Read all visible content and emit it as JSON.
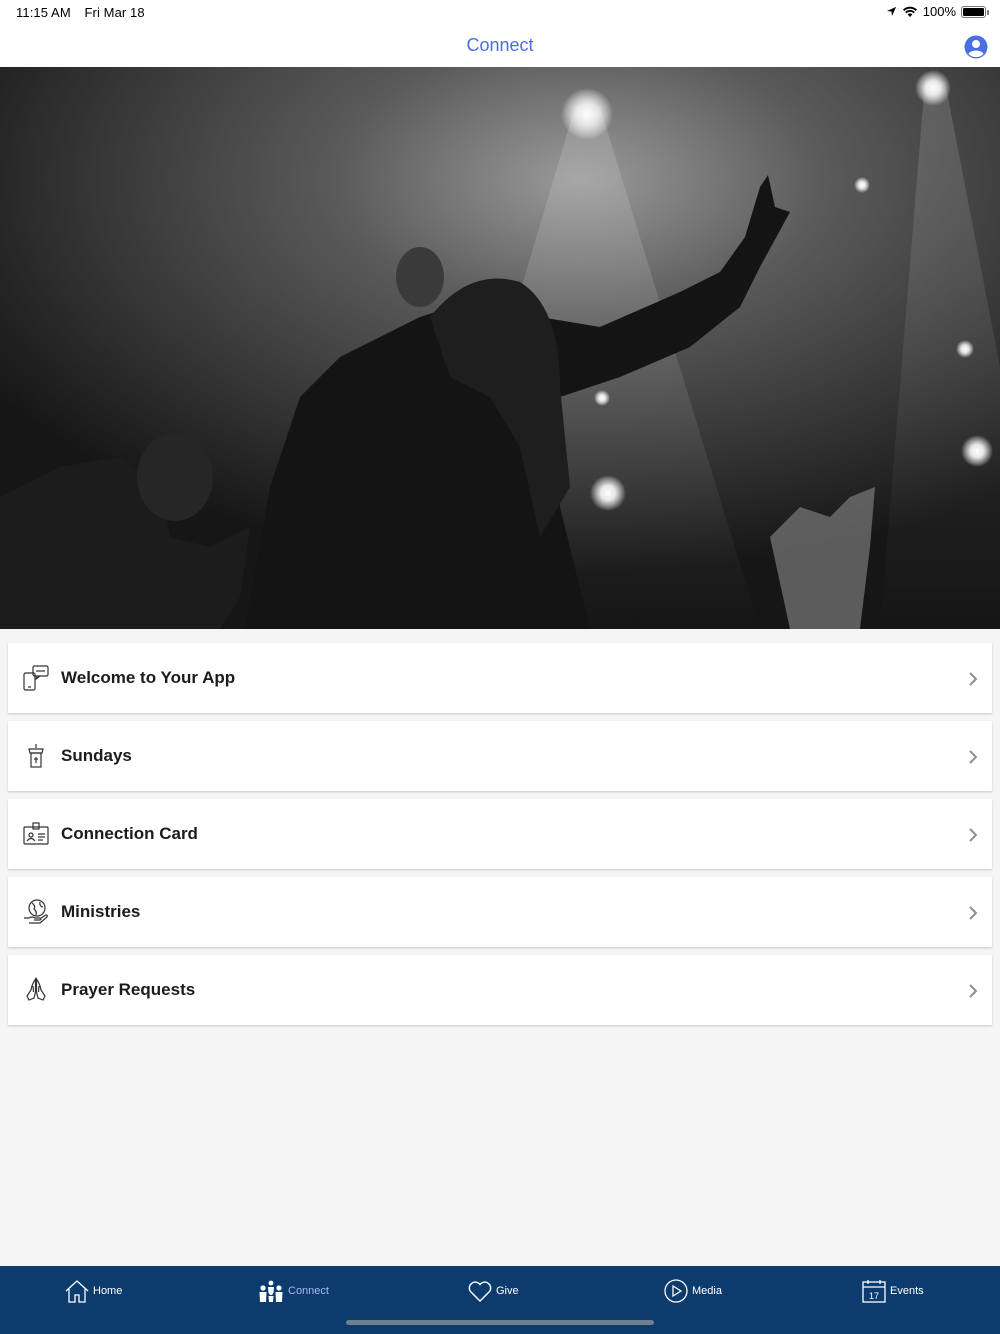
{
  "status_bar": {
    "time": "11:15 AM",
    "date": "Fri Mar 18",
    "battery": "100%",
    "icons": [
      "location-arrow-icon",
      "wifi-icon",
      "battery-icon"
    ]
  },
  "nav": {
    "title": "Connect",
    "title_color": "#4a6fe0",
    "profile_icon": "user-circle-icon"
  },
  "hero": {
    "description_icon": "worship-photo"
  },
  "list": [
    {
      "label": "Welcome to Your App",
      "icon": "phone-chat-icon"
    },
    {
      "label": "Sundays",
      "icon": "pulpit-icon"
    },
    {
      "label": "Connection Card",
      "icon": "id-card-icon"
    },
    {
      "label": "Ministries",
      "icon": "globe-hand-icon"
    },
    {
      "label": "Prayer Requests",
      "icon": "praying-hands-icon"
    }
  ],
  "tab_bar": {
    "background": "#0c3c6e",
    "tabs": [
      {
        "label": "Home",
        "icon": "home-icon",
        "active": false
      },
      {
        "label": "Connect",
        "icon": "people-icon",
        "active": true
      },
      {
        "label": "Give",
        "icon": "heart-icon",
        "active": false
      },
      {
        "label": "Media",
        "icon": "play-circle-icon",
        "active": false
      },
      {
        "label": "Events",
        "icon": "calendar-icon",
        "active": false,
        "calendar_day": "17"
      }
    ]
  }
}
